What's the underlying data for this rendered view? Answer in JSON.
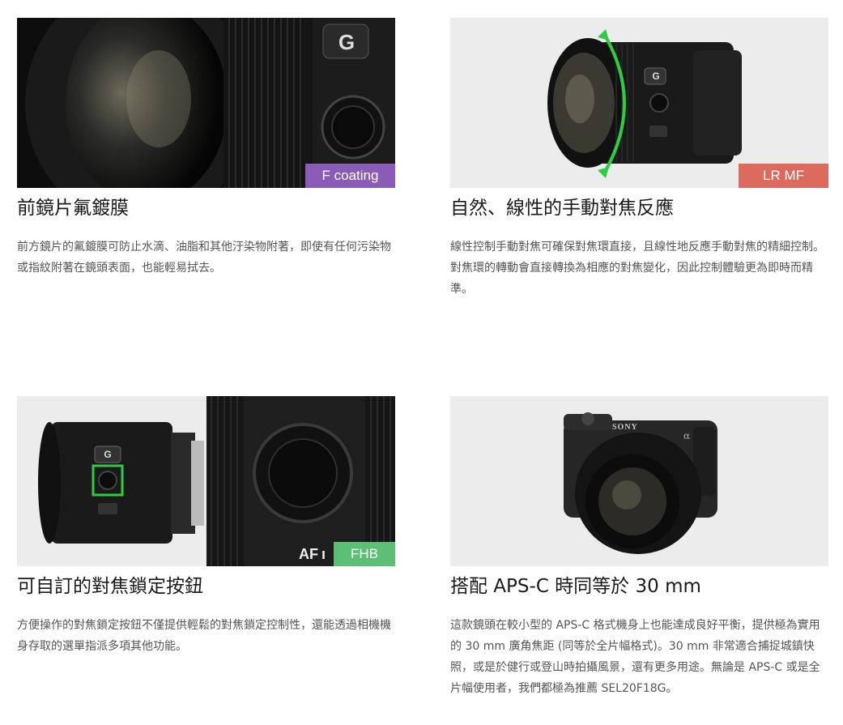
{
  "cards": [
    {
      "title": "前鏡片氟鍍膜",
      "tag": "F coating",
      "desc": "前方鏡片的氟鍍膜可防止水滴、油脂和其他汙染物附著，即使有任何污染物或指紋附著在鏡頭表面，也能輕易拭去。",
      "colors": {
        "tag": "#8a5cb8"
      }
    },
    {
      "title": "自然、線性的手動對焦反應",
      "tag": "LR MF",
      "desc": "線性控制手動對焦可確保對焦環直接，且線性地反應手動對焦的精細控制。對焦環的轉動會直接轉換為相應的對焦變化，因此控制體驗更為即時而精準。",
      "colors": {
        "tag": "#dc6b5d",
        "arrow": "#2ecc40"
      }
    },
    {
      "title": "可自訂的對焦鎖定按鈕",
      "tag": "FHB",
      "tag2": "AF",
      "desc": "方便操作的對焦鎖定按鈕不僅提供輕鬆的對焦鎖定控制性，還能透過相機機身存取的選單指派多項其他功能。",
      "colors": {
        "tag": "#5bbf74",
        "highlight": "#2ecc40"
      }
    },
    {
      "title": "搭配 APS-C 時同等於 30 mm",
      "desc": "這款鏡頭在較小型的 APS-C 格式機身上也能達成良好平衡，提供極為實用的 30 mm 廣角焦距 (同等於全片幅格式)。30 mm 非常適合捕捉城鎮快照，或是於健行或登山時拍攝風景，還有更多用途。無論是 APS-C 或是全片幅使用者，我們都極為推薦 SEL20F18G。"
    }
  ],
  "lens_marks": {
    "g_badge": "G",
    "brand": "SONY",
    "alpha": "α"
  }
}
